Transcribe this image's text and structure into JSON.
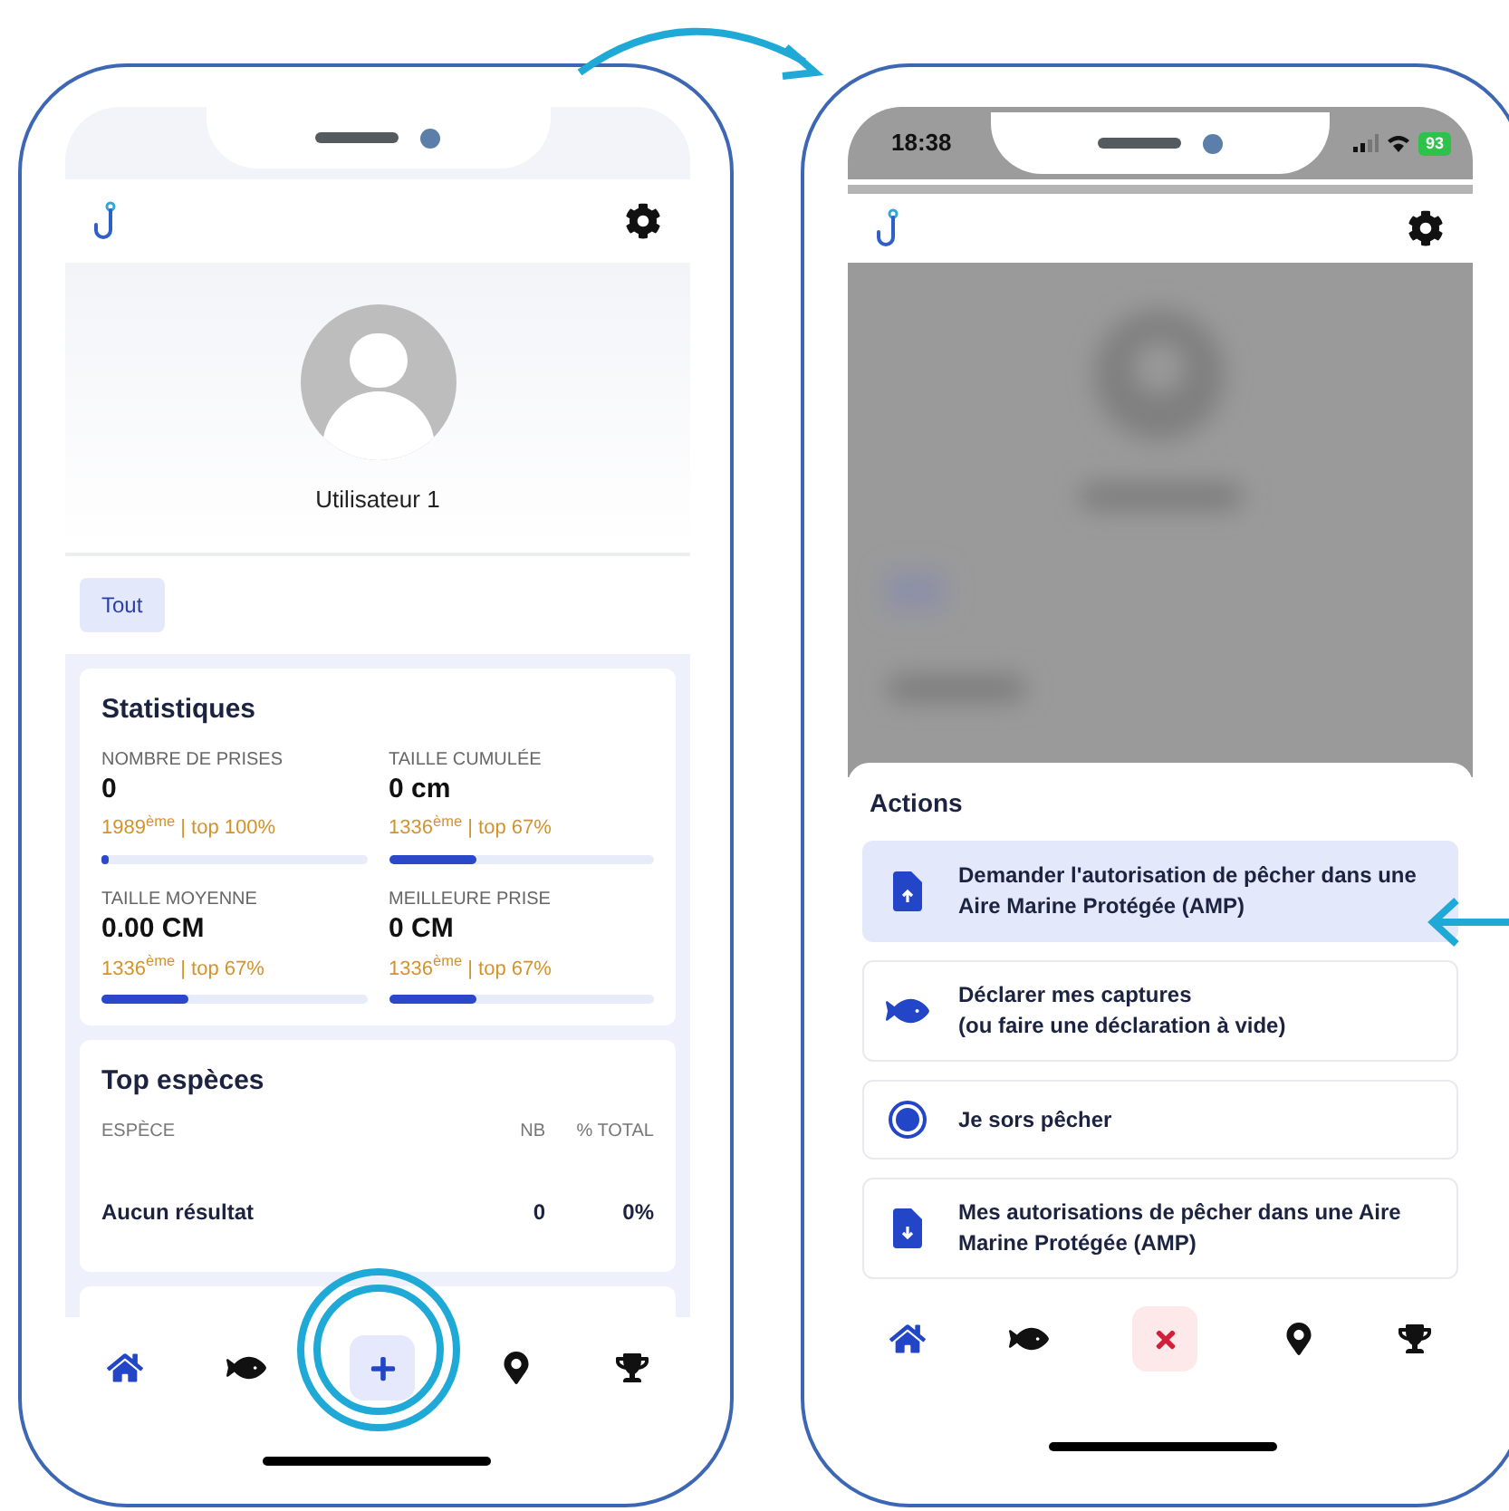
{
  "left_phone": {
    "user": {
      "name": "Utilisateur 1"
    },
    "filters": [
      {
        "label": "Tout",
        "selected": true
      }
    ],
    "statistics": {
      "title": "Statistiques",
      "items": [
        {
          "label": "NOMBRE DE PRISES",
          "value": "0",
          "rank": "1989$^{ème}$ | top 100%",
          "level": 0
        },
        {
          "label": "TAILLE CUMULÉE",
          "value": "0 cm",
          "rank": "1336$^{ème}$ | top 67%",
          "level": 0.33
        },
        {
          "label": "TAILLE MOYENNE",
          "value": "0.00 CM",
          "rank": "1336$^{ème}$ | top 67%",
          "level": 0.33
        },
        {
          "label": "MEILLEURE PRISE",
          "value": "0 CM",
          "rank": "1336$^{ème}$ | top 67%",
          "level": 0.33
        }
      ]
    },
    "top_species": {
      "title": "Top espèces",
      "columns": [
        "ESPÈCE",
        "NB",
        "% TOTAL"
      ],
      "rows": [
        [
          "Aucun résultat",
          "0",
          "0%"
        ]
      ]
    },
    "nav": [
      {
        "kind": "home",
        "selected": true
      },
      {
        "kind": "fish",
        "selected": false
      },
      {
        "kind": "add",
        "selected": false
      },
      {
        "kind": "pin",
        "selected": false
      },
      {
        "kind": "trophy",
        "selected": false
      }
    ]
  },
  "right_phone": {
    "status_bar": {
      "time": "18:38",
      "battery": "93"
    },
    "actions": {
      "title": "Actions",
      "items": [
        {
          "kind": "upload",
          "text": "Demander l'autorisation de pêcher dans une Aire Marine Protégée (AMP)",
          "selected": true
        },
        {
          "kind": "fish",
          "text": "Déclarer mes captures\n(ou faire une déclaration à vide)",
          "selected": false
        },
        {
          "kind": "radio",
          "text": "Je sors pêcher",
          "selected": false
        },
        {
          "kind": "download",
          "text": "Mes autorisations de pêcher dans une Aire Marine Protégée (AMP)",
          "selected": false
        }
      ]
    },
    "nav": [
      {
        "kind": "home",
        "selected": true
      },
      {
        "kind": "fish",
        "selected": false
      },
      {
        "kind": "close",
        "selected": false
      },
      {
        "kind": "pin",
        "selected": false
      },
      {
        "kind": "trophy",
        "selected": false
      }
    ]
  }
}
